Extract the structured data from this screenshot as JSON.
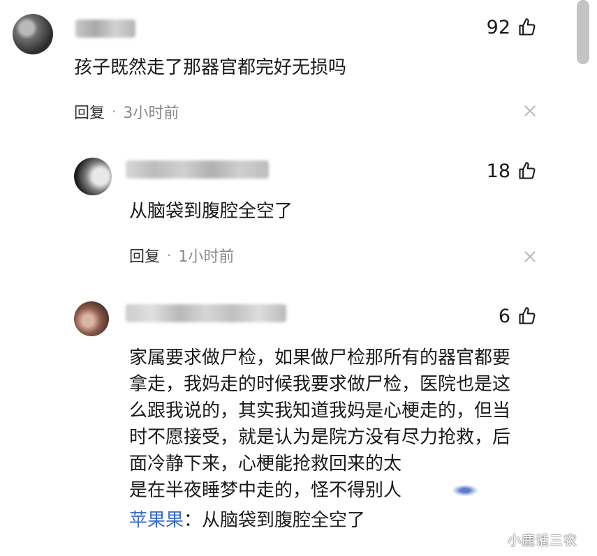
{
  "comments": [
    {
      "username": "",
      "likes": "92",
      "text": "孩子既然走了那器官都完好无损吗",
      "reply_label": "回复",
      "time": "3小时前"
    },
    {
      "username": "",
      "likes": "18",
      "text": "从脑袋到腹腔全空了",
      "reply_label": "回复",
      "time": "1小时前"
    },
    {
      "username": "",
      "likes": "6",
      "lines": [
        "家属要求做尸检，如果做尸检那所有的器官都要",
        "拿走，我妈走的时候我要求做尸检，医院也是这",
        "么跟我说的，其实我知道我妈是心梗走的，但当",
        "时不愿接受，就是认为是院方没有尽力抢救，后",
        "面冷静下来，心梗能抢救回来的太",
        "是在半夜睡梦中走的，怪不得别人"
      ],
      "quoted_author": "苹果果",
      "quoted_text": "：从脑袋到腹腔全空了"
    }
  ],
  "watermark": "小鹿话三农",
  "icons": {
    "like": "thumbs-up-icon",
    "close": "close-icon"
  },
  "colors": {
    "reply_author": "#3a6cc8",
    "meta_time": "#8a8a8a"
  }
}
